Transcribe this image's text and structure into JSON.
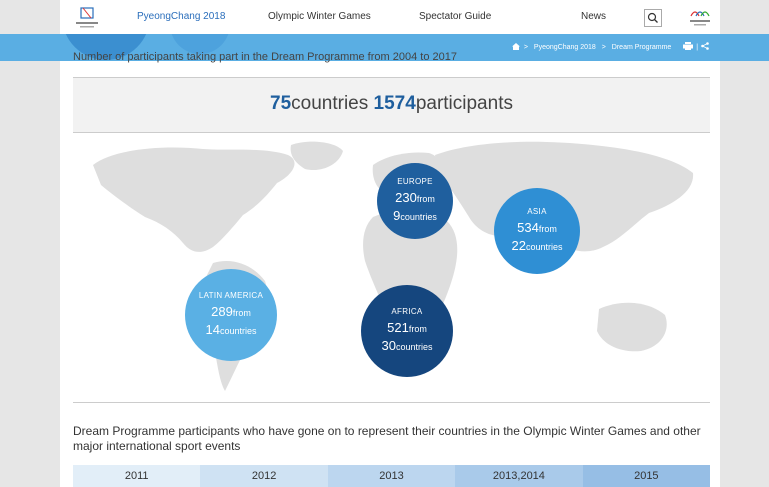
{
  "nav": {
    "links": [
      "PyeongChang 2018",
      "Olympic Winter Games",
      "Spectator Guide",
      "News"
    ],
    "search_icon": "search-icon",
    "logo_left_icon": "pyeongchang-logo",
    "logo_right_icon": "paralympic-logo"
  },
  "breadcrumb": {
    "home_icon": "home-icon",
    "items": [
      "PyeongChang 2018",
      "Dream Programme"
    ],
    "separator": ">",
    "print_icon": "print-icon",
    "share_icon": "share-icon"
  },
  "content": {
    "cut_title": "Number of participants taking part in the Dream Programme from 2004 to 2017",
    "stats": {
      "countries_num": "75",
      "countries_label": "countries",
      "participants_num": "1574",
      "participants_label": "participants"
    },
    "regions": [
      {
        "name": "EUROPE",
        "participants": "230",
        "from": "from",
        "countries": "9",
        "countries_label": "countries",
        "color": "#1f5f9e"
      },
      {
        "name": "ASIA",
        "participants": "534",
        "from": "from",
        "countries": "22",
        "countries_label": "countries",
        "color": "#2f8fd4"
      },
      {
        "name": "LATIN AMERICA",
        "participants": "289",
        "from": "from",
        "countries": "14",
        "countries_label": "countries",
        "color": "#5ab0e4"
      },
      {
        "name": "AFRICA",
        "participants": "521",
        "from": "from",
        "countries": "30",
        "countries_label": "countries",
        "color": "#15467e"
      }
    ],
    "section_title": "Dream Programme participants who have gone on to represent their countries in the Olympic Winter Games and other major international sport events",
    "years": [
      {
        "label": "2011",
        "color": "#e2eef8"
      },
      {
        "label": "2012",
        "color": "#cfe2f3"
      },
      {
        "label": "2013",
        "color": "#bcd6ef"
      },
      {
        "label": "2013,2014",
        "color": "#a9caea"
      },
      {
        "label": "2015",
        "color": "#96bee5"
      }
    ]
  }
}
